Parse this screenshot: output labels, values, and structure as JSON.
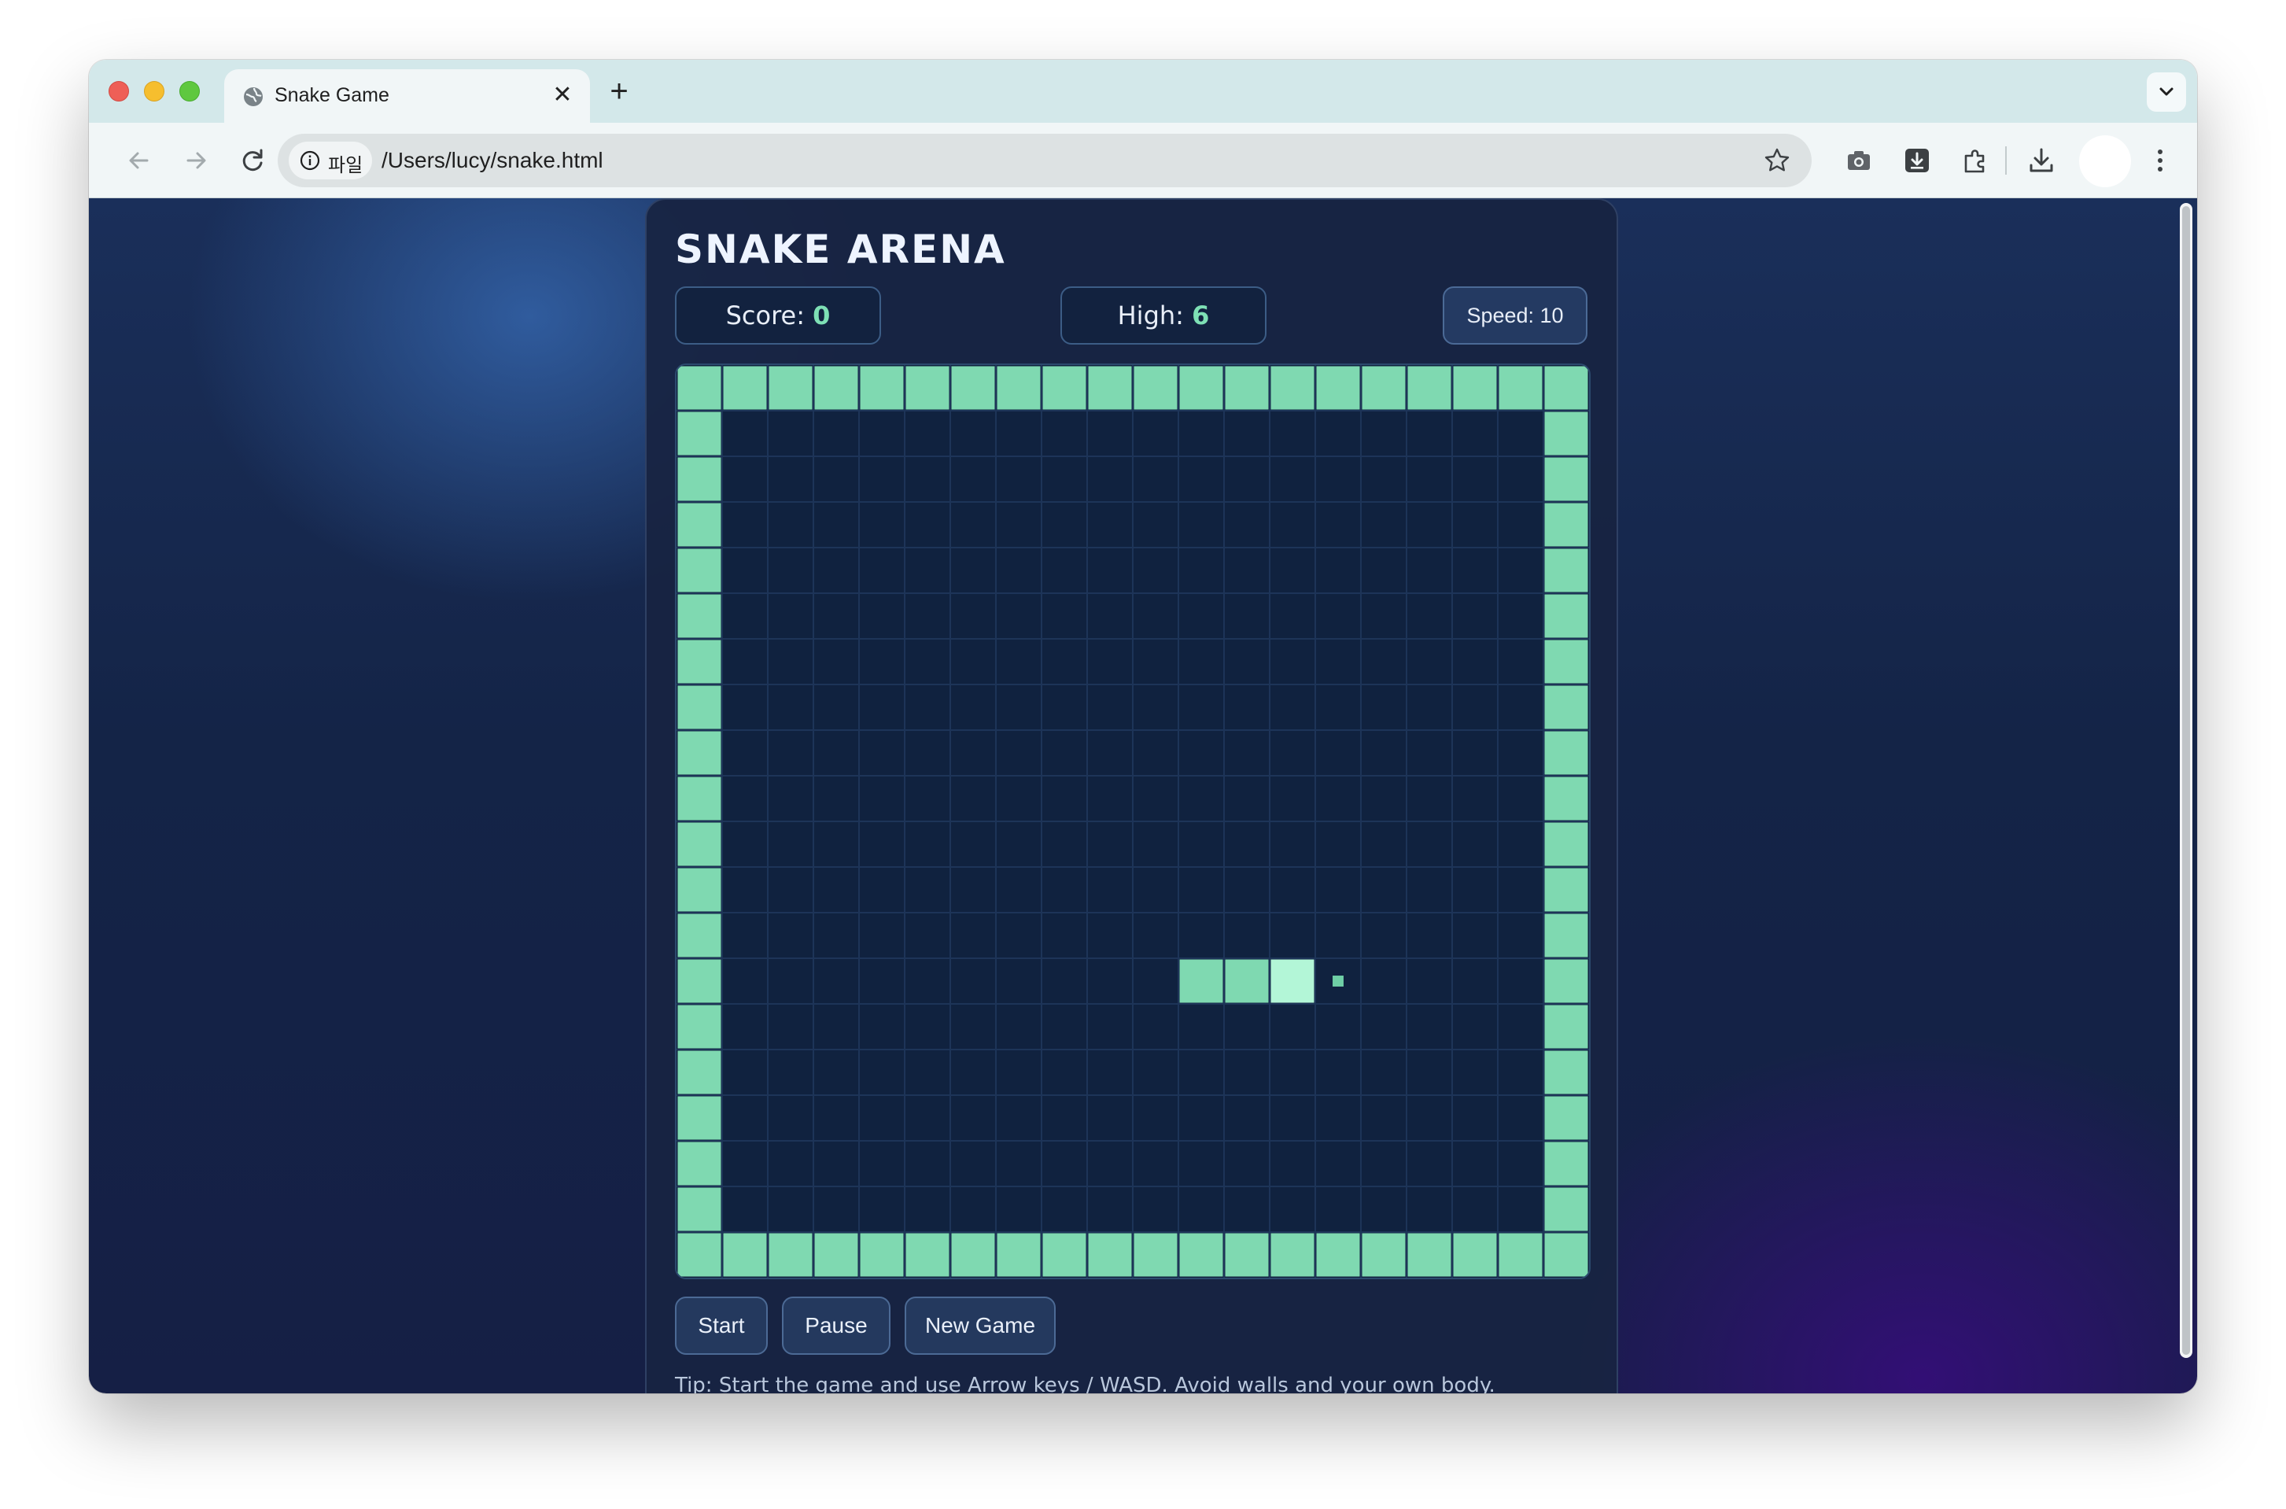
{
  "browser": {
    "tab_title": "Snake Game",
    "close_glyph": "✕",
    "new_tab_glyph": "+",
    "site_chip": "파일",
    "url": "/Users/lucy/snake.html",
    "icons": [
      "globe-icon",
      "close-icon",
      "plus-icon",
      "chevron-down-icon",
      "back-arrow-icon",
      "forward-arrow-icon",
      "reload-icon",
      "info-icon",
      "star-icon",
      "camera-icon",
      "save-extension-icon",
      "puzzle-icon",
      "download-icon",
      "profile-avatar",
      "kebab-menu-icon"
    ]
  },
  "game": {
    "title": "SNAKE ARENA",
    "score_label": "Score: ",
    "score_value": "0",
    "high_label": "High: ",
    "high_value": "6",
    "speed_text": "Speed: 10",
    "buttons": {
      "start": "Start",
      "pause": "Pause",
      "new_game": "New Game"
    },
    "tip": "Tip: Start the game and use Arrow keys / WASD. Avoid walls and your own body.",
    "grid": {
      "cols": 20,
      "rows": 20,
      "walls": "border",
      "snake": [
        [
          13,
          13
        ],
        [
          12,
          13
        ],
        [
          11,
          13
        ]
      ],
      "food": [
        14,
        13
      ]
    },
    "colors": {
      "wall": "#7fd9b1",
      "snake_body": "#7fd9b1",
      "snake_head": "#b3f6d7",
      "food": "#6fcfa6",
      "grid_line": "#1d3458",
      "board_bg": "#10223f",
      "accent": "#7ee0b5"
    }
  }
}
